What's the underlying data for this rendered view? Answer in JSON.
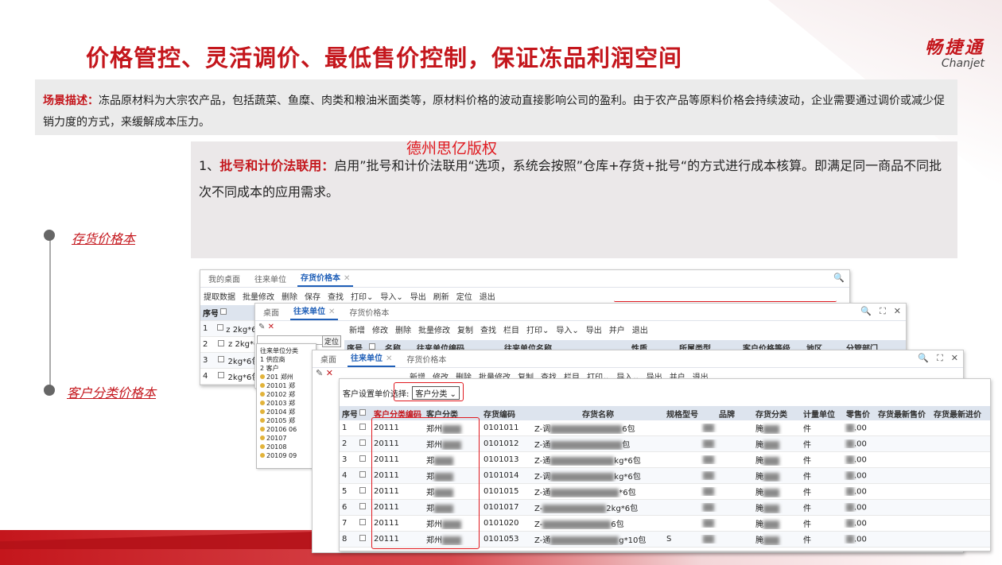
{
  "slide": {
    "title": "价格管控、灵活调价、最低售价控制，保证冻品利润空间",
    "logo_cn": "畅捷通",
    "logo_en": "Chanjet",
    "scenario_label": "场景描述：",
    "scenario_text": "冻品原材料为大宗农产品，包括蔬菜、鱼糜、肉类和粮油米面类等，原材料价格的波动直接影响公司的盈利。由于农产品等原料价格会持续波动，企业需要通过调价或减少促销力度的方式，来缓解成本压力。",
    "watermark": "德州思亿版权",
    "feature_prefix": "1、",
    "feature_label": "批号和计价法联用：",
    "feature_text": "启用”批号和计价法联用“选项，系统会按照”仓库+存货+批号“的方式进行成本核算。即满足同一商品不同批次不同成本的应用需求。",
    "timeline": [
      "存货价格本",
      "客户分类价格本"
    ],
    "colors": {
      "brand_red": "#c4161c",
      "link_blue": "#1f5fb8"
    }
  },
  "win1": {
    "tabs": [
      "我的桌面",
      "往来单位",
      "存货价格本"
    ],
    "toolbar": [
      "提取数据",
      "批量修改",
      "删除",
      "保存",
      "查找",
      "打印",
      "导入",
      "导出",
      "刷新",
      "定位",
      "退出"
    ],
    "rows": [
      {
        "no": "序号",
        "item": ""
      },
      {
        "no": "1",
        "item": "z 2kg*6包"
      },
      {
        "no": "2",
        "item": "z 2kg*6"
      },
      {
        "no": "3",
        "item": "2kg*6包"
      },
      {
        "no": "4",
        "item": "2kg*6包"
      }
    ]
  },
  "win2": {
    "tabs": [
      "桌面",
      "往来单位",
      "存货价格本"
    ],
    "toolbar": [
      "新增",
      "修改",
      "删除",
      "批量修改",
      "复制",
      "查找",
      "栏目",
      "打印",
      "导入",
      "导出",
      "并户",
      "退出"
    ],
    "headers": [
      "序号",
      "",
      "名称",
      "往来单位编码",
      "往来单位名称",
      "性质",
      "所属类型",
      "客户价格等级",
      "地区",
      "分管部门"
    ],
    "locate_btn": "定位"
  },
  "tree": {
    "items": [
      "往来单位分类",
      "1 供应商",
      "2 客户",
      "201 郑州",
      "20101 郑",
      "20102 郑",
      "20103 郑",
      "20104 郑",
      "20105 郑",
      "20106 06",
      "20107",
      "20108",
      "20109 09"
    ]
  },
  "win3": {
    "tabs": [
      "桌面",
      "往来单位",
      "存货价格本"
    ],
    "toolbar": [
      "新增",
      "修改",
      "删除",
      "批量修改",
      "复制",
      "查找",
      "栏目",
      "打印",
      "导入",
      "导出",
      "并户",
      "退出"
    ],
    "selector_label": "客户设置单价选择:",
    "selector_value": "客户分类",
    "headers": [
      "序号",
      "",
      "客户分类编码",
      "客户分类",
      "存货编码",
      "存货名称",
      "规格型号",
      "品牌",
      "存货分类",
      "计量单位",
      "零售价",
      "存货最新售价",
      "存货最新进价"
    ],
    "rows": [
      {
        "no": "1",
        "cls_code": "20111",
        "cls": "郑州",
        "code": "0101011",
        "name": "Z-调",
        "spec": "6包",
        "brand": "",
        "cat": "腌",
        "unit": "件",
        "price": ".00"
      },
      {
        "no": "2",
        "cls_code": "20111",
        "cls": "郑州",
        "code": "0101012",
        "name": "Z-通",
        "spec": "包",
        "brand": "",
        "cat": "腌",
        "unit": "件",
        "price": ".00"
      },
      {
        "no": "3",
        "cls_code": "20111",
        "cls": "郑",
        "code": "0101013",
        "name": "Z-通",
        "spec": "kg*6包",
        "brand": "",
        "cat": "腌",
        "unit": "件",
        "price": ".00"
      },
      {
        "no": "4",
        "cls_code": "20111",
        "cls": "郑",
        "code": "0101014",
        "name": "Z-调",
        "spec": "kg*6包",
        "brand": "",
        "cat": "腌",
        "unit": "件",
        "price": ".00"
      },
      {
        "no": "5",
        "cls_code": "20111",
        "cls": "郑",
        "code": "0101015",
        "name": "Z-通",
        "spec": "*6包",
        "brand": "",
        "cat": "腌",
        "unit": "件",
        "price": ".00"
      },
      {
        "no": "6",
        "cls_code": "20111",
        "cls": "郑",
        "code": "0101017",
        "name": "Z-",
        "spec": "2kg*6包",
        "brand": "",
        "cat": "腌",
        "unit": "件",
        "price": ".00"
      },
      {
        "no": "7",
        "cls_code": "20111",
        "cls": "郑州",
        "code": "0101020",
        "name": "Z-",
        "spec": "6包",
        "brand": "",
        "cat": "腌",
        "unit": "件",
        "price": ".00"
      },
      {
        "no": "8",
        "cls_code": "20111",
        "cls": "郑州",
        "code": "0101053",
        "name": "Z-通",
        "spec": "g*10包",
        "brand": "S",
        "cat": "腌",
        "unit": "件",
        "price": ".00"
      }
    ]
  }
}
